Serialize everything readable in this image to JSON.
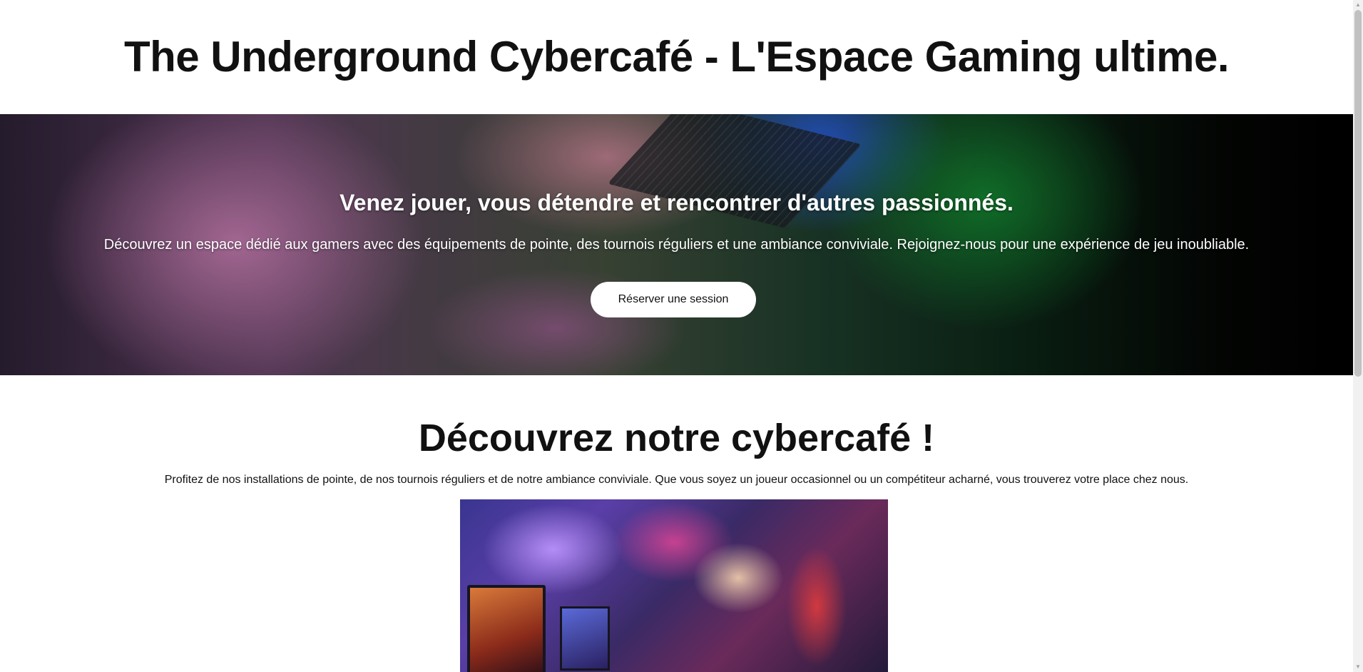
{
  "header": {
    "title": "The Underground Cybercafé - L'Espace Gaming ultime."
  },
  "hero": {
    "heading": "Venez jouer, vous détendre et rencontrer d'autres passionnés.",
    "text": "Découvrez un espace dédié aux gamers avec des équipements de pointe, des tournois réguliers et une ambiance conviviale. Rejoignez-nous pour une expérience de jeu inoubliable.",
    "button_label": "Réserver une session"
  },
  "discover": {
    "title": "Découvrez notre cybercafé !",
    "text": "Profitez de nos installations de pointe, de nos tournois réguliers et de notre ambiance conviviale. Que vous soyez un joueur occasionnel ou un compétiteur acharné, vous trouverez votre place chez nous."
  },
  "scrollbar": {
    "up_icon": "▲",
    "down_icon": "▼"
  }
}
